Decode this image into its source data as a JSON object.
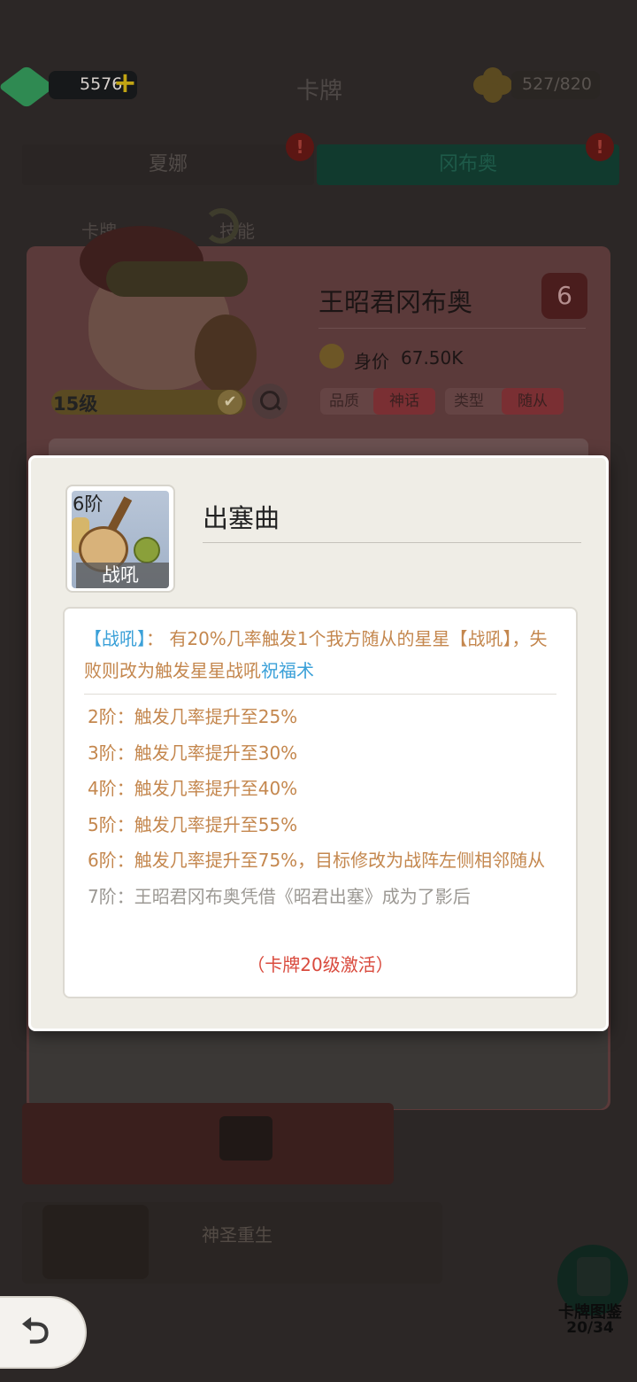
{
  "topbar": {
    "gem_count": "5576",
    "title": "卡牌",
    "capacity": "527/820"
  },
  "tabs": [
    {
      "label": "夏娜",
      "badge": "!"
    },
    {
      "label": "冈布奥",
      "badge": "!"
    }
  ],
  "sub_labels": [
    "卡牌",
    "技能"
  ],
  "card": {
    "name": "王昭君冈布奥",
    "star": "6",
    "worth_label": "身价",
    "worth_value": "67.50K",
    "level": "15级",
    "quality_key": "品质",
    "quality_value": "神话",
    "type_key": "类型",
    "type_value": "随从"
  },
  "bottom": {
    "card2_title": "神圣重生"
  },
  "cardbook": {
    "label": "卡牌图鉴",
    "count": "20/34"
  },
  "back_icon": "back-arrow",
  "dialog": {
    "skill": {
      "tier": "6阶",
      "caption": "战吼",
      "name": "出塞曲"
    },
    "description": {
      "tag": "【战吼】",
      "text_1": "： 有20%几率触发1个我方随从的星星【战吼】，失败则改为触发星星战吼",
      "link": "祝福术"
    },
    "tiers": [
      "2阶：触发几率提升至25%",
      "3阶：触发几率提升至30%",
      "4阶：触发几率提升至40%",
      "5阶：触发几率提升至55%",
      "6阶：触发几率提升至75%，目标修改为战阵左侧相邻随从",
      "7阶：王昭君冈布奥凭借《昭君出塞》成为了影后"
    ],
    "activate_note": "（卡牌20级激活）"
  },
  "colors": {
    "accent_text": "#c4874e",
    "link_blue": "#3aa0d8",
    "warning_red": "#d94a3d",
    "dialog_bg": "#efede6"
  }
}
